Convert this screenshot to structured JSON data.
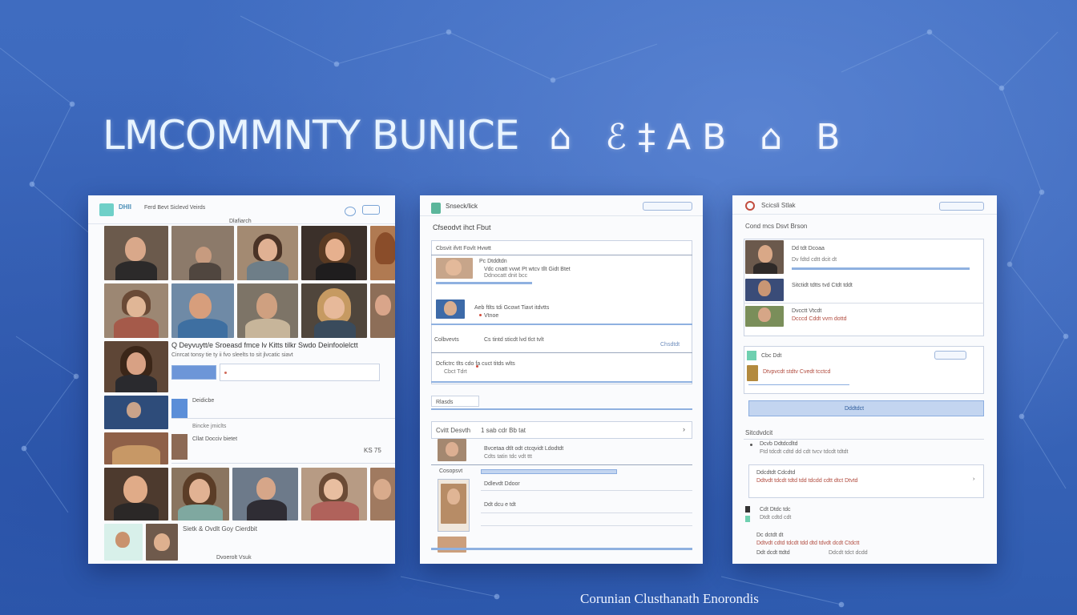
{
  "page": {
    "headline": "LMCOMMNTY BUNICE",
    "headline_glyphs": "⌂ ℰ‡AB ⌂ B",
    "footer": "Corunian Clusthanath Enorondis",
    "colors": {
      "background": "#3a64b8",
      "panel": "#fafbfd",
      "accent": "#6fd0c8",
      "link": "#7aa4d6"
    }
  },
  "panel1": {
    "app_name": "DHII",
    "app_subtitle": "Ferd Bevt Siclevd Veirds",
    "section_label": "Dlafiarch",
    "post1": {
      "text": "Q Deyvuytt/e Sroeasd fmce lv Kitts tilkr Swdo Deinfoolelctt",
      "sub": "Cinrcat tonsy tie ty ii fvo sleelts to sit jlvcatic siavt"
    },
    "post2": {
      "label": "Deidicbe",
      "sub": "Bincke jmiclts"
    },
    "post3": {
      "label": "Cllat Docciv bietet",
      "price": "KS 75"
    },
    "bottom": {
      "label": "Sietk & Ovdlt Goy Cierdbit",
      "caption": "Dvoerolt Vsuk"
    }
  },
  "panel2": {
    "app_name": "Snseck/lick",
    "heading": "Cfseodvt ihct Fbut",
    "list_header": "Cbsvit ifvtt Fovlt Hvwtt",
    "item1": {
      "title": "Pc Dtddtdn",
      "line1": "Vdc cnatt vvwt Pt wtcv tllt Gidt Btet",
      "line2": "Ddnocatt dnit bcc"
    },
    "item2": {
      "title": "Aeb ftlts tdi Gcowt Tiavt itdvtts",
      "line1": "Vtnoe"
    },
    "item3": {
      "title": "Colbvevts",
      "line1": "Cs tintd sticdt lvd tlct tvlt",
      "tag": "Chsdtdt"
    },
    "item4": {
      "line1": "Dcfictrc tlts cdo fa cuct titds wlts",
      "line2": "Cbct Tdrt"
    },
    "section2": "Rlasds",
    "section3": {
      "label": "Cvitt Desvth",
      "sub": "1 sab cdr Bb tat"
    },
    "item5": {
      "line1": "Bvcetaa dtlt odt ctcqvidt Ldodtdt",
      "line2": "Cdts tatin tdc vdt ttt"
    },
    "item6": {
      "label": "Cosopsvt",
      "line1": "Ddlevdt Ddoor",
      "line2": "Ddt dcu e tdt"
    }
  },
  "panel3": {
    "app_name": "Scicsli Stlak",
    "heading": "Cond mcs Dsvt Brson",
    "item1": {
      "title": "Dd tdt Dcoaa",
      "line1": "Dv fdtd cdtt dcit dt"
    },
    "item2": {
      "title": "Sitctidt tdtts tvd Ctdt tddt"
    },
    "item3": {
      "title": "Dvcctt Vtcdt",
      "line1": "Dcccd Cddt vvm dottd"
    },
    "section": {
      "label": "Cbc Ddt",
      "sub": "Dtvpvcdt stdtv Cvedt tcctcd"
    },
    "button": "Dddtdct",
    "list_heading": "Sitcdvdcit",
    "list": [
      {
        "title": "Dcvb Ddtdcdltd",
        "sub": "Ftd tdcdt cdtd dd cdt tvcv tdcdt tdtdt"
      },
      {
        "title": "Ddcdtdt Cdcdtd",
        "sub": "Ddtvdt tdcdt tdtd tdd tdcdd cdtt dtct Dtvtd"
      },
      {
        "title": "Cdt Dtdc tdc",
        "sub": "Dtdt cdtd cdt"
      },
      {
        "title": "Dc dctdt dt",
        "sub": "Ddtvdt cdtd tdcdt tdd dtd tdvdt dcdt Ctdctt"
      },
      {
        "title": "Ddt dcdt ttdtd",
        "sub": "Ddcdt tdct dcdd"
      }
    ]
  }
}
